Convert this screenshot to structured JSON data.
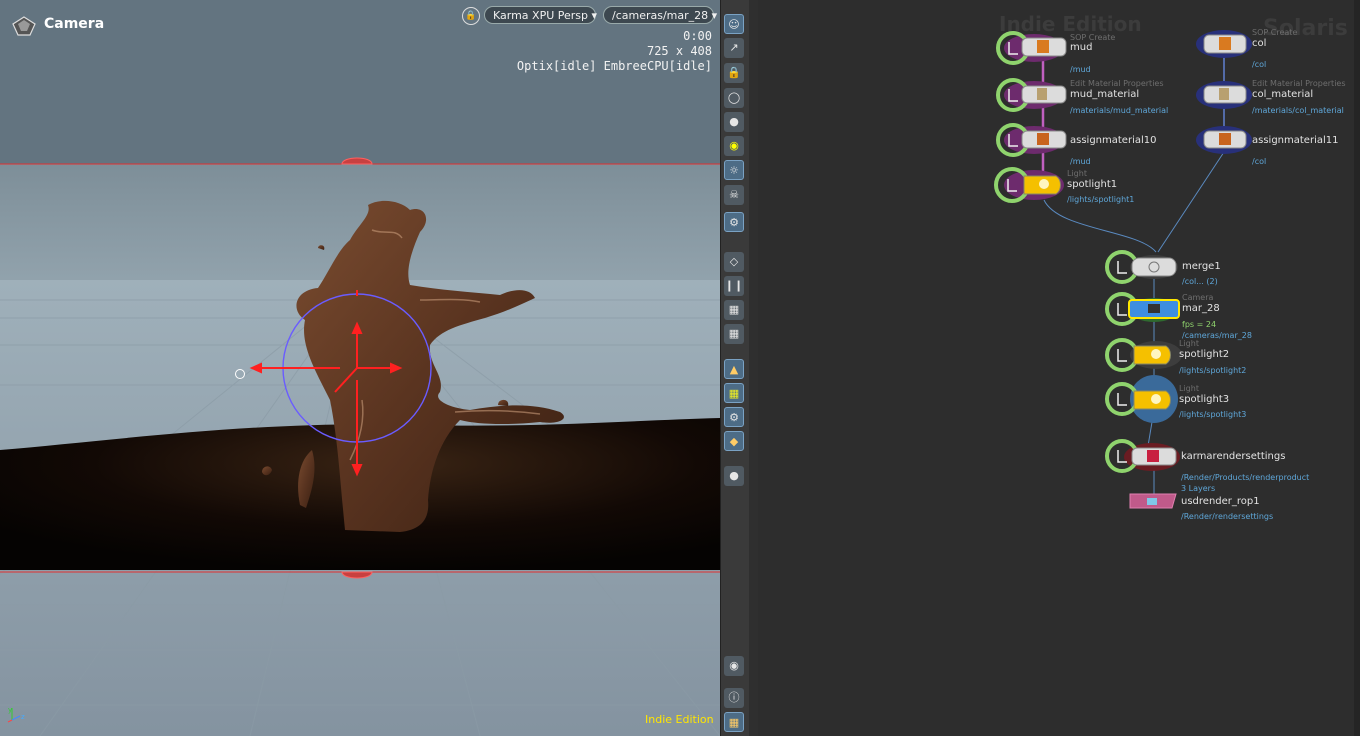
{
  "viewport": {
    "title": "Camera",
    "renderer_dropdown": "Karma XPU  Persp",
    "camera_dropdown": "/cameras/mar_28",
    "lock_icon": "lock-icon",
    "time": "0:00",
    "resolution": "725 x 408",
    "engine_status": "Optix[idle]  EmbreeCPU[idle]",
    "edition_label": "Indie Edition",
    "colors": {
      "guide_frame": "#e03030",
      "manipulator": "#6a5cff",
      "handle": "#ff2020",
      "mud": "#5a3420"
    }
  },
  "toolbar": {
    "icons": [
      "display-options-icon",
      "select-icon",
      "lock-view-icon",
      "lights-icon",
      "shading-icon",
      "camera-icon",
      "light-toggle-icon",
      "render-icon",
      "snapshot-icon",
      "ghost-icon",
      "pause-icon",
      "flipbook-icon",
      "safe-area-icon",
      "lighting-mode-icon",
      "guide-icon",
      "background-icon",
      "render-settings-icon",
      "sphere-icon",
      "eye-icon",
      "info-icon",
      "layout-icon"
    ]
  },
  "network": {
    "watermark_edition": "Indie Edition",
    "watermark_context": "Solaris",
    "nodes": [
      {
        "id": "mud",
        "type": "SOP Create",
        "name": "mud",
        "path": "/mud",
        "extra": ""
      },
      {
        "id": "mud_material",
        "type": "Edit Material Properties",
        "name": "mud_material",
        "path": "/materials/mud_material",
        "extra": ""
      },
      {
        "id": "assignmaterial10",
        "type": "",
        "name": "assignmaterial10",
        "path": "/mud",
        "extra": ""
      },
      {
        "id": "spotlight1",
        "type": "Light",
        "name": "spotlight1",
        "path": "/lights/spotlight1",
        "extra": ""
      },
      {
        "id": "col",
        "type": "SOP Create",
        "name": "col",
        "path": "/col",
        "extra": ""
      },
      {
        "id": "col_material",
        "type": "Edit Material Properties",
        "name": "col_material",
        "path": "/materials/col_material",
        "extra": ""
      },
      {
        "id": "assignmaterial11",
        "type": "",
        "name": "assignmaterial11",
        "path": "/col",
        "extra": ""
      },
      {
        "id": "merge1",
        "type": "",
        "name": "merge1",
        "path": "/col... (2)",
        "extra": ""
      },
      {
        "id": "mar_28",
        "type": "Camera",
        "name": "mar_28",
        "path": "/cameras/mar_28",
        "extra": "fps = 24"
      },
      {
        "id": "spotlight2",
        "type": "Light",
        "name": "spotlight2",
        "path": "/lights/spotlight2",
        "extra": ""
      },
      {
        "id": "spotlight3",
        "type": "Light",
        "name": "spotlight3",
        "path": "/lights/spotlight3",
        "extra": ""
      },
      {
        "id": "karmarendersettings",
        "type": "",
        "name": "karmarendersettings",
        "path": "/Render/Products/renderproduct",
        "extra": "3 Layers"
      },
      {
        "id": "usdrender_rop1",
        "type": "",
        "name": "usdrender_rop1",
        "path": "/Render/rendersettings",
        "extra": ""
      }
    ]
  }
}
